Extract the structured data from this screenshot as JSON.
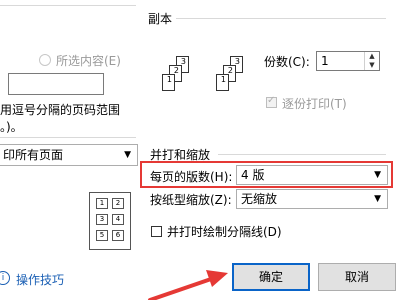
{
  "page_range": {
    "selection_label": "所选内容(E)",
    "hint_line1": "用逗号分隔的页码范围",
    "hint_line2": "。)。"
  },
  "print_select": {
    "value": "印所有页面"
  },
  "copies": {
    "section_title": "副本",
    "count_label": "份数(C):",
    "count_value": "1",
    "collate_label": "逐份打印(T)",
    "collate_checked": true,
    "stack_a": [
      "1",
      "2",
      "3"
    ],
    "stack_b": [
      "1",
      "2",
      "3"
    ]
  },
  "zoom": {
    "section_title": "并打和缩放",
    "pages_per_sheet_label": "每页的版数(H):",
    "pages_per_sheet_value": "4 版",
    "scale_label": "按纸型缩放(Z):",
    "scale_value": "无缩放",
    "draw_lines_label": "并打时绘制分隔线(D)",
    "draw_lines_checked": false,
    "nup_preview": [
      "1",
      "2",
      "3",
      "4",
      "5",
      "6"
    ]
  },
  "footer": {
    "tips_label": "操作技巧",
    "ok_label": "确定",
    "cancel_label": "取消"
  },
  "colors": {
    "highlight": "#e53935",
    "arrow": "#e53935",
    "primary_border": "#0a64c8",
    "link": "#1a5fb4"
  }
}
